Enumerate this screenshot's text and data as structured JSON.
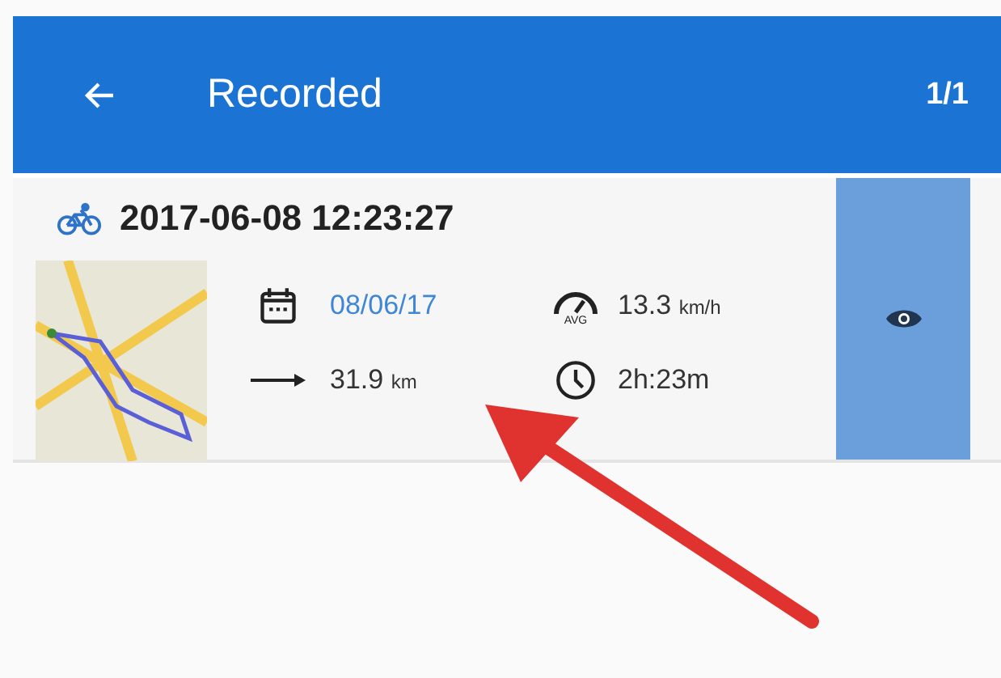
{
  "app_bar": {
    "title": "Recorded",
    "counter": "1/1"
  },
  "tracks": [
    {
      "kind": "cycling",
      "title": "2017-06-08 12:23:27",
      "date": "08/06/17",
      "avg_label": "AVG",
      "speed": "13.3",
      "speed_unit": "km/h",
      "distance": "31.9",
      "distance_unit": "km",
      "duration": "2h:23m",
      "selected": true
    }
  ]
}
